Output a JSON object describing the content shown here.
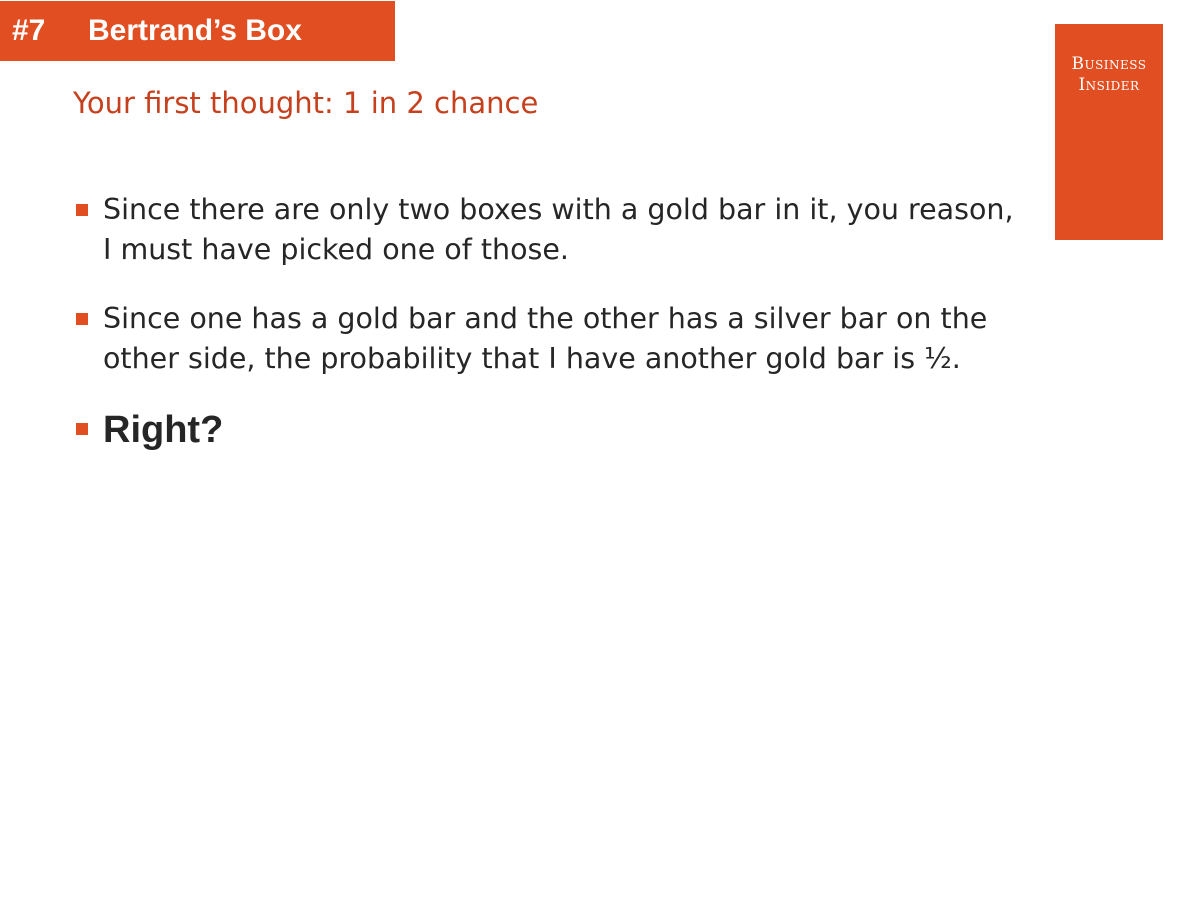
{
  "slide": {
    "number": "#7",
    "title": "Bertrand’s Box",
    "subtitle": "Your first thought: 1 in 2 chance",
    "bullets": [
      "Since there are only two boxes with a gold bar in it, you reason, I must have picked one of those.",
      "Since one has a gold bar and the other has a silver bar on the other side, the probability that I have another gold bar is ½.",
      "Right?"
    ]
  },
  "logo": {
    "line1": "Business",
    "line2": "Insider"
  },
  "colors": {
    "accent": "#e04e21",
    "subtitle": "#c6401e",
    "text": "#262626"
  }
}
